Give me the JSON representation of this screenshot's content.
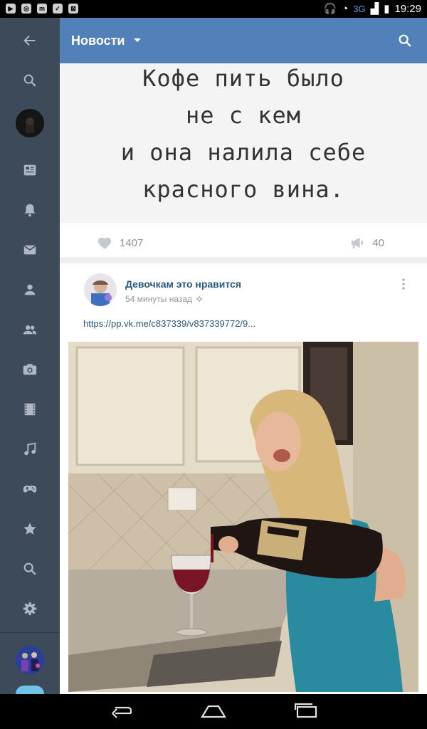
{
  "status_bar": {
    "network": "3G",
    "time": "19:29"
  },
  "sidebar": {
    "items": [
      "back-icon",
      "search-icon",
      "avatar",
      "news-icon",
      "notifications-icon",
      "messages-icon",
      "profile-icon",
      "friends-icon",
      "photos-icon",
      "videos-icon",
      "music-icon",
      "games-icon",
      "favorites-icon",
      "search-icon",
      "settings-icon"
    ]
  },
  "header": {
    "title": "Новости"
  },
  "post1": {
    "quote_lines": [
      "Кофе пить было",
      "не с кем",
      "и она налила себе",
      "красного вина."
    ],
    "likes": "1407",
    "shares": "40"
  },
  "post2": {
    "author": "Девочкам это нравится",
    "time": "54 минуты назад",
    "link": "https://pp.vk.me/c837339/v837339772/9..."
  },
  "colors": {
    "header": "#5181b8",
    "sidebar": "#3d4a5a",
    "link": "#2a5885"
  }
}
